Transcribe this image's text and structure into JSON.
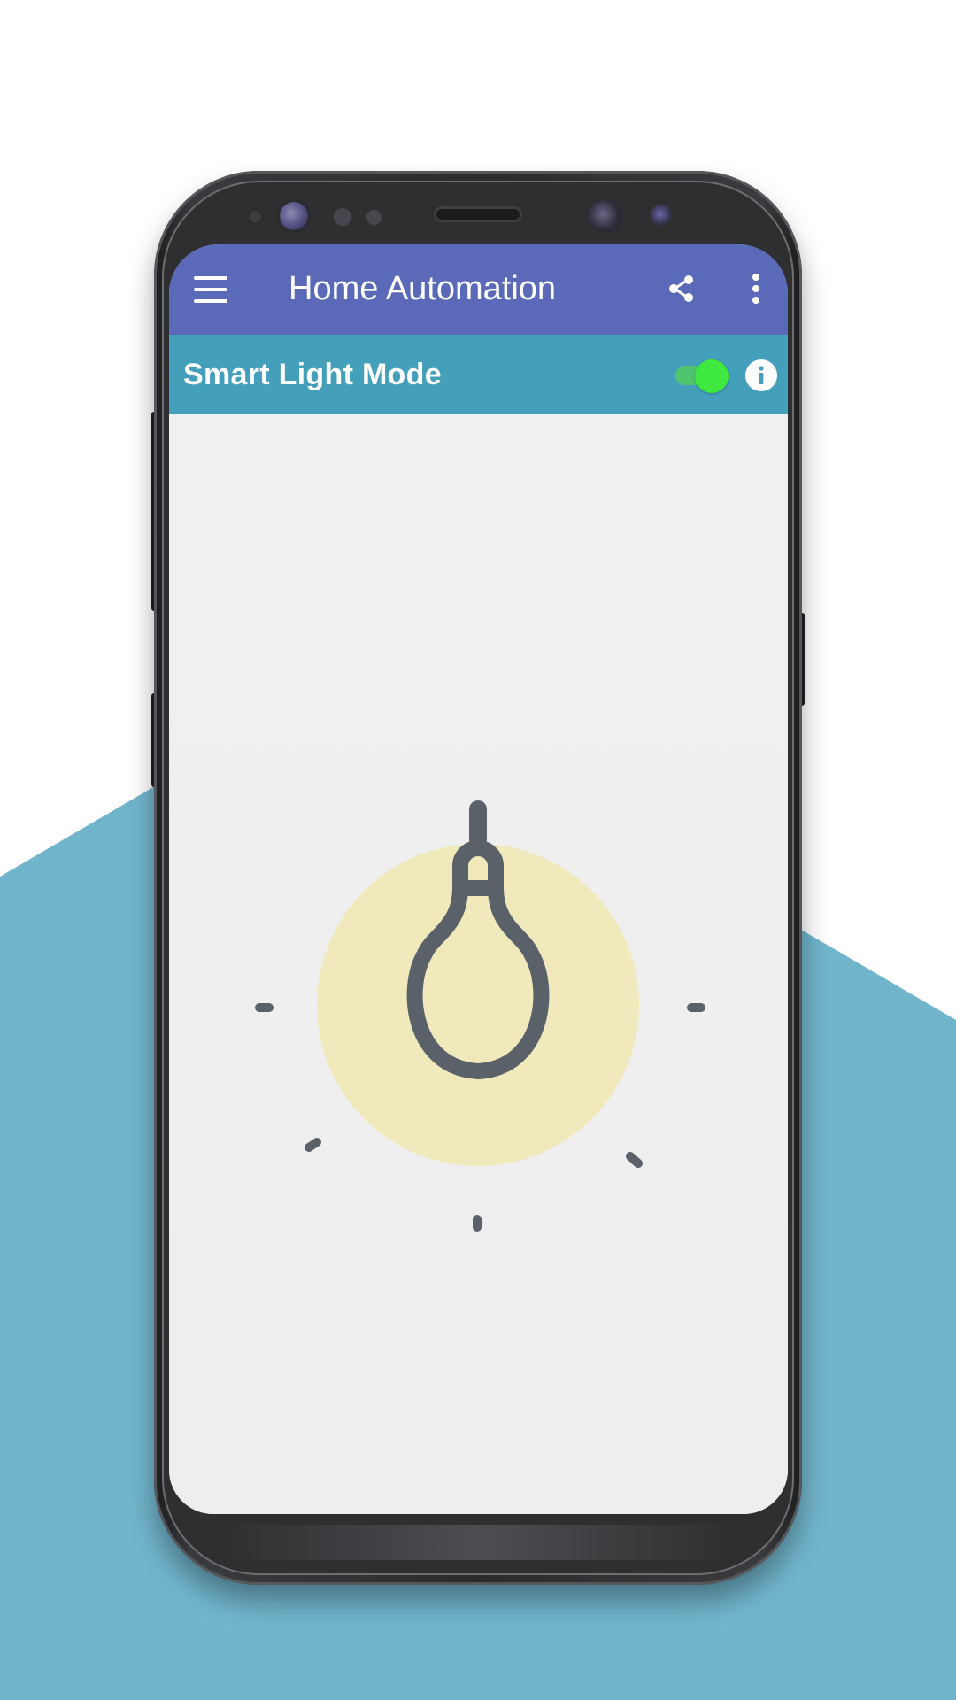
{
  "app": {
    "title": "Home Automation"
  },
  "appbar": {
    "menu_icon": "hamburger-menu-icon",
    "share_icon": "share-icon",
    "more_icon": "more-vertical-icon"
  },
  "mode": {
    "label": "Smart Light Mode",
    "toggle_on": true,
    "info_icon": "info-icon"
  },
  "main": {
    "light_icon": "light-bulb-icon",
    "light_on": true
  },
  "colors": {
    "appbar": "#5b6ab8",
    "modebar": "#449fba",
    "toggle_thumb": "#3ee83e",
    "bulb_glow": "#efe9bb",
    "bulb_stroke": "#5b6168",
    "backdrop_accent": "#71b5cc"
  }
}
